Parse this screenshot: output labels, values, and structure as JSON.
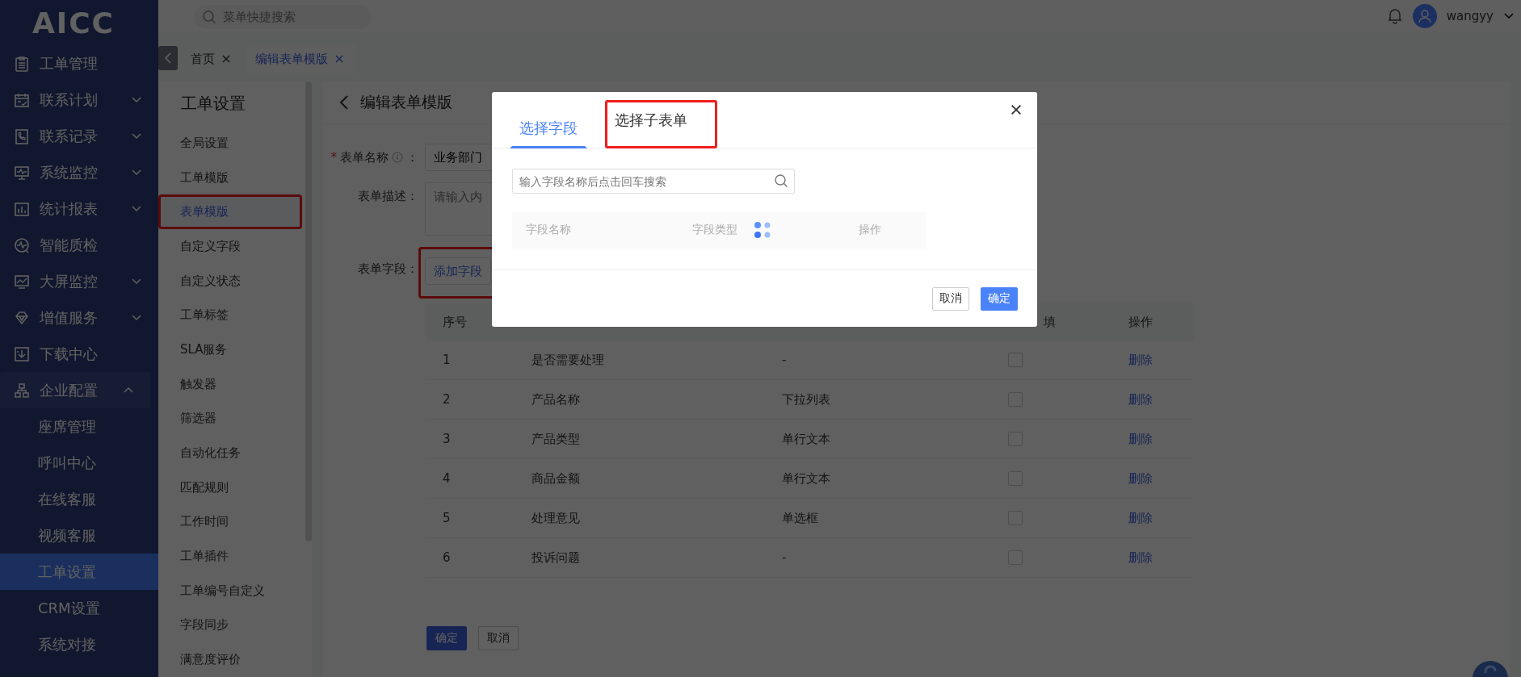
{
  "logo": "AICC",
  "topbar": {
    "search_placeholder": "菜单快捷搜索",
    "user": "wangyy"
  },
  "nav": [
    {
      "label": "工单管理",
      "kind": "link",
      "selected": false
    },
    {
      "label": "联系计划",
      "kind": "group",
      "expanded": false,
      "selected": false
    },
    {
      "label": "联系记录",
      "kind": "group",
      "expanded": false,
      "selected": false
    },
    {
      "label": "系统监控",
      "kind": "group",
      "expanded": false,
      "selected": false
    },
    {
      "label": "统计报表",
      "kind": "group",
      "expanded": false,
      "selected": false
    },
    {
      "label": "智能质检",
      "kind": "link",
      "selected": false
    },
    {
      "label": "大屏监控",
      "kind": "group",
      "expanded": false,
      "selected": false
    },
    {
      "label": "增值服务",
      "kind": "group",
      "expanded": false,
      "selected": false
    },
    {
      "label": "下载中心",
      "kind": "link",
      "selected": false
    },
    {
      "label": "企业配置",
      "kind": "group",
      "expanded": true,
      "selected": false,
      "children": [
        {
          "label": "座席管理",
          "selected": false
        },
        {
          "label": "呼叫中心",
          "selected": false
        },
        {
          "label": "在线客服",
          "selected": false
        },
        {
          "label": "视频客服",
          "selected": false
        },
        {
          "label": "工单设置",
          "selected": true
        },
        {
          "label": "CRM设置",
          "selected": false
        },
        {
          "label": "系统对接",
          "selected": false
        }
      ]
    }
  ],
  "page_tabs": [
    {
      "label": "首页",
      "selected": false
    },
    {
      "label": "编辑表单模版",
      "selected": true
    }
  ],
  "settings_menu": {
    "title": "工单设置",
    "items": [
      {
        "label": "全局设置",
        "selected": false,
        "highlighted": false
      },
      {
        "label": "工单模版",
        "selected": false,
        "highlighted": false
      },
      {
        "label": "表单模版",
        "selected": true,
        "highlighted": true
      },
      {
        "label": "自定义字段",
        "selected": false,
        "highlighted": false
      },
      {
        "label": "自定义状态",
        "selected": false,
        "highlighted": false
      },
      {
        "label": "工单标签",
        "selected": false,
        "highlighted": false
      },
      {
        "label": "SLA服务",
        "selected": false,
        "highlighted": false
      },
      {
        "label": "触发器",
        "selected": false,
        "highlighted": false
      },
      {
        "label": "筛选器",
        "selected": false,
        "highlighted": false
      },
      {
        "label": "自动化任务",
        "selected": false,
        "highlighted": false
      },
      {
        "label": "匹配规则",
        "selected": false,
        "highlighted": false
      },
      {
        "label": "工作时间",
        "selected": false,
        "highlighted": false
      },
      {
        "label": "工单插件",
        "selected": false,
        "highlighted": false
      },
      {
        "label": "工单编号自定义",
        "selected": false,
        "highlighted": false
      },
      {
        "label": "字段同步",
        "selected": false,
        "highlighted": false
      },
      {
        "label": "满意度评价",
        "selected": false,
        "highlighted": false
      }
    ]
  },
  "form": {
    "title": "编辑表单模版",
    "name_field": {
      "label": "表单名称",
      "colon": "：",
      "required": true,
      "required_mark": "*",
      "value": "业务部门"
    },
    "description_field": {
      "label": "表单描述：",
      "placeholder": "请输入内"
    },
    "fields_label": "表单字段：",
    "add_button": {
      "label": "添加字段",
      "highlighted": true
    },
    "table": {
      "columns": {
        "index": "序号",
        "required": "填",
        "action": "操作"
      },
      "rows": [
        {
          "index": "1",
          "name": "是否需要处理",
          "type": "-",
          "required": false,
          "action": "删除"
        },
        {
          "index": "2",
          "name": "产品名称",
          "type": "下拉列表",
          "required": false,
          "action": "删除"
        },
        {
          "index": "3",
          "name": "产品类型",
          "type": "单行文本",
          "required": false,
          "action": "删除"
        },
        {
          "index": "4",
          "name": "商品金额",
          "type": "单行文本",
          "required": false,
          "action": "删除"
        },
        {
          "index": "5",
          "name": "处理意见",
          "type": "单选框",
          "required": false,
          "action": "删除"
        },
        {
          "index": "6",
          "name": "投诉问题",
          "type": "-",
          "required": false,
          "action": "删除"
        }
      ]
    },
    "buttons": [
      {
        "label": "确定",
        "kind": "primary"
      },
      {
        "label": "取消",
        "kind": "default"
      }
    ]
  },
  "dialog": {
    "tabs": [
      {
        "label": "选择字段",
        "selected": true,
        "highlighted": false
      },
      {
        "label": "选择子表单",
        "selected": false,
        "highlighted": true
      }
    ],
    "search_placeholder": "输入字段名称后点击回车搜索",
    "columns": [
      "字段名称",
      "字段类型",
      "操作"
    ],
    "loading": true,
    "buttons": [
      {
        "label": "取消",
        "kind": "default"
      },
      {
        "label": "确定",
        "kind": "primary"
      }
    ]
  }
}
